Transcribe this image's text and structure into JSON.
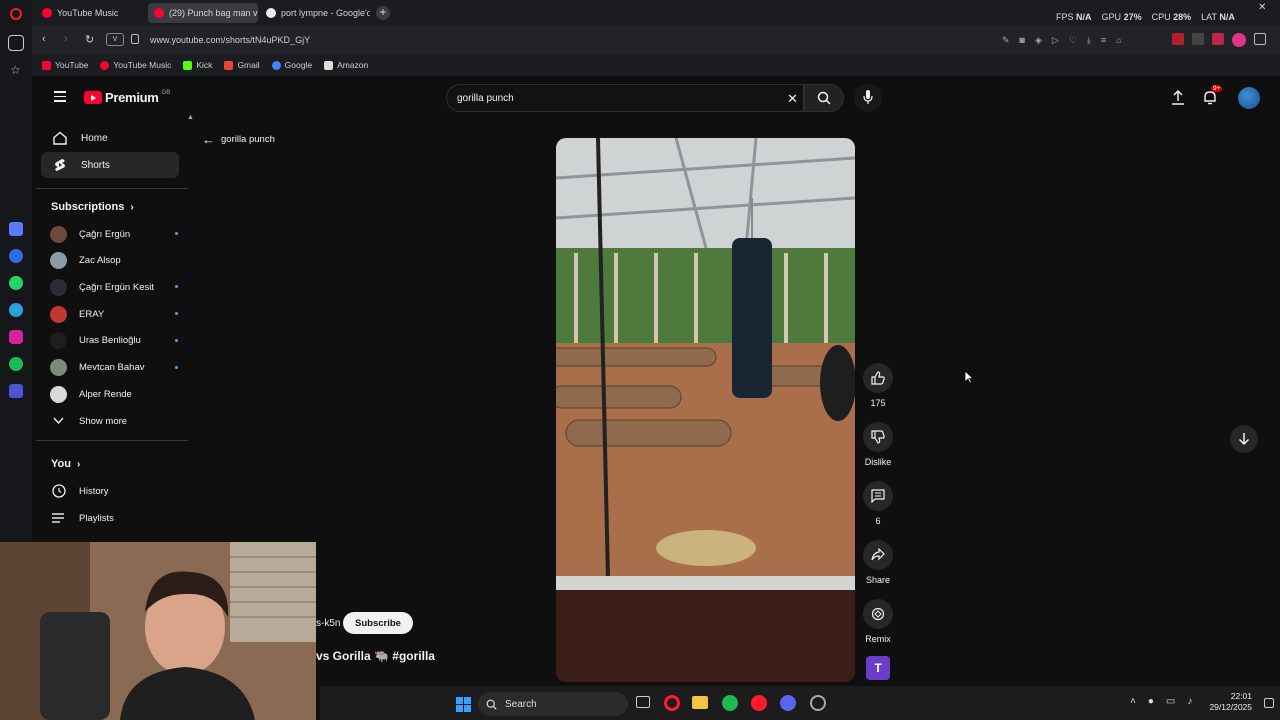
{
  "browser": {
    "tabs": [
      {
        "label": "YouTube Music",
        "active": false
      },
      {
        "label": "(29) Punch bag man v",
        "active": true
      },
      {
        "label": "port lympne - Google'da A",
        "active": false
      }
    ],
    "url": "www.youtube.com/shorts/tN4uPKD_GjY",
    "bookmarks": [
      "YouTube",
      "YouTube Music",
      "Kick",
      "Gmail",
      "Google",
      "Amazon"
    ],
    "stats": {
      "fps_label": "FPS",
      "fps_value": "N/A",
      "gpu_label": "GPU",
      "gpu_value": "27%",
      "cpu_label": "CPU",
      "cpu_value": "28%",
      "lat_label": "LAT",
      "lat_value": "N/A"
    }
  },
  "youtube": {
    "logo": "Premium",
    "region": "GB",
    "search_query": "gorilla punch",
    "notifications": "9+",
    "back_label": "gorilla punch",
    "sidebar": {
      "main": [
        {
          "label": "Home",
          "icon": "home-icon"
        },
        {
          "label": "Shorts",
          "icon": "shorts-icon"
        }
      ],
      "subscriptions_title": "Subscriptions",
      "subscriptions": [
        {
          "name": "Çağrı Ergün",
          "live": true,
          "color": "#6b4a3a"
        },
        {
          "name": "Zac Alsop",
          "live": false,
          "color": "#8a9aa8"
        },
        {
          "name": "Çağrı Ergün Kesit",
          "live": true,
          "color": "#2b2b3a"
        },
        {
          "name": "ERAY",
          "live": true,
          "color": "#c0392b"
        },
        {
          "name": "Uras Benlioğlu",
          "live": true,
          "color": "#1e1e1e"
        },
        {
          "name": "Mevtcan Bahav",
          "live": true,
          "color": "#7a8b7a"
        },
        {
          "name": "Alper Rende",
          "live": false,
          "color": "#d9d9d9"
        }
      ],
      "show_more": "Show more",
      "you_title": "You",
      "you_items": [
        {
          "label": "History",
          "icon": "history-icon"
        },
        {
          "label": "Playlists",
          "icon": "playlists-icon"
        }
      ]
    },
    "short": {
      "channel_fragment": "s-k5n",
      "subscribe": "Subscribe",
      "title_fragment": "vs Gorilla 🐃 #gorilla"
    },
    "actions": {
      "likes": "175",
      "dislike": "Dislike",
      "comments": "6",
      "share": "Share",
      "remix": "Remix",
      "avatar_letter": "T"
    }
  },
  "taskbar": {
    "search": "Search",
    "time": "22:01",
    "date": "29/12/2025"
  },
  "colors": {
    "accent_red": "#ff0033",
    "bg": "#0f0f0f",
    "live_blue": "#3ea6ff",
    "remix_purple": "#6a3ec7"
  }
}
